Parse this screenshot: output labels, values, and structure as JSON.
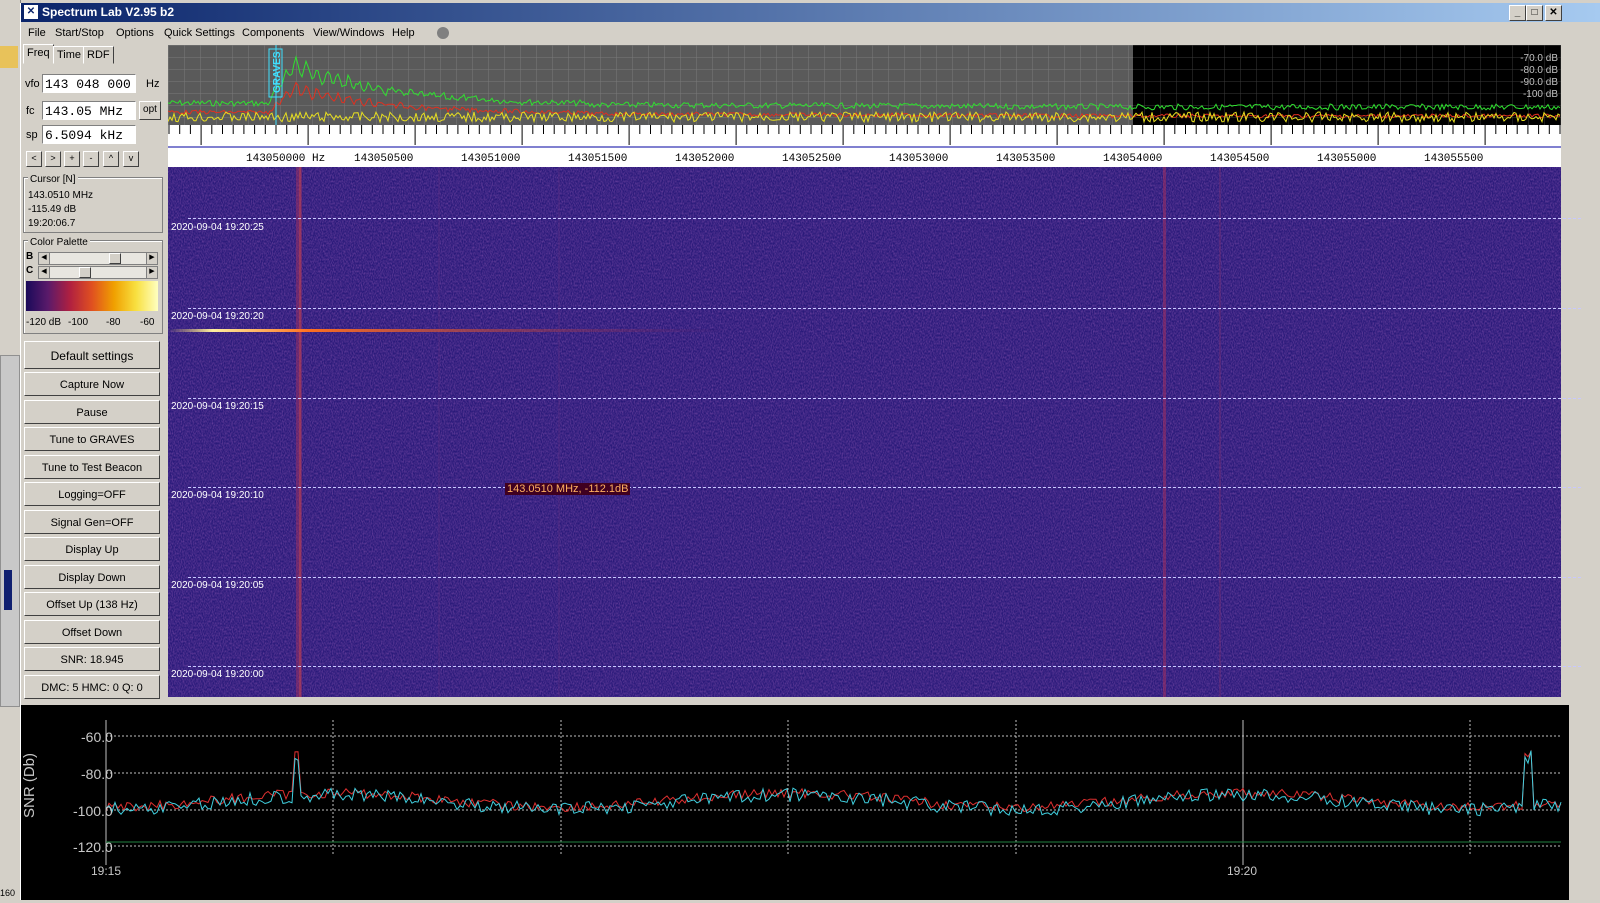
{
  "window": {
    "title": "Spectrum Lab V2.95 b2",
    "buttons": {
      "minimize": "_",
      "maximize": "□",
      "close": "✕"
    }
  },
  "menu": [
    "File",
    "Start/Stop",
    "Options",
    "Quick Settings",
    "Components",
    "View/Windows",
    "Help"
  ],
  "tabs": [
    "Freq",
    "Time",
    "RDF"
  ],
  "freq_panel": {
    "vfo_label": "vfo",
    "vfo_value": "143 048 000",
    "vfo_unit": "Hz",
    "fc_label": "fc",
    "fc_value": "143.05 MHz",
    "opt_label": "opt",
    "sp_label": "sp",
    "sp_value": "6.5094 kHz",
    "nav_buttons": [
      "<",
      ">",
      "+",
      "-",
      "^",
      "v"
    ]
  },
  "cursor": {
    "title": "Cursor [N]",
    "freq": "143.0510 MHz",
    "level": "-115.49 dB",
    "time": "19:20:06.7"
  },
  "palette": {
    "title": "Color Palette",
    "b_label": "B",
    "c_label": "C",
    "scale": [
      "-120 dB",
      "-100",
      "-80",
      "-60"
    ]
  },
  "buttons": [
    "Default settings",
    "Capture Now",
    "Pause",
    "Tune to GRAVES",
    "Tune to Test Beacon",
    "Logging=OFF",
    "Signal Gen=OFF",
    "Display Up",
    "Display Down",
    "Offset Up (138 Hz)",
    "Offset Down",
    "SNR: 18.945",
    "DMC: 5 HMC: 0 Q: 0"
  ],
  "spectrum": {
    "db_labels": [
      "-70.0 dB",
      "-80.0 dB",
      "-90.0 dB",
      "-100 dB"
    ],
    "marker_label": "GRAVES",
    "freq_ticks": [
      "143050000 Hz",
      "143050500",
      "143051000",
      "143051500",
      "143052000",
      "143052500",
      "143053000",
      "143053500",
      "143054000",
      "143054500",
      "143055000",
      "143055500"
    ]
  },
  "waterfall": {
    "times": [
      "2020-09-04 19:20:25",
      "2020-09-04 19:20:20",
      "2020-09-04 19:20:15",
      "2020-09-04 19:20:10",
      "2020-09-04 19:20:05",
      "2020-09-04 19:20:00"
    ],
    "readout": "143.0510 MHz, -112.1dB"
  },
  "snr_plot": {
    "ylabel": "SNR (Db)",
    "y_ticks": [
      "-60.0",
      "-80.0",
      "-100.0",
      "-120.0"
    ],
    "x_ticks": [
      "19:15",
      "19:20"
    ]
  },
  "desktop": {
    "corner_number": "160"
  },
  "colors": {
    "titlebar_start": "#0a246a",
    "waterfall_bg": "#2a1a7a",
    "spectrum_green": "#30e030",
    "spectrum_yellow": "#e8e020",
    "snr_cyan": "#40d0e0"
  }
}
